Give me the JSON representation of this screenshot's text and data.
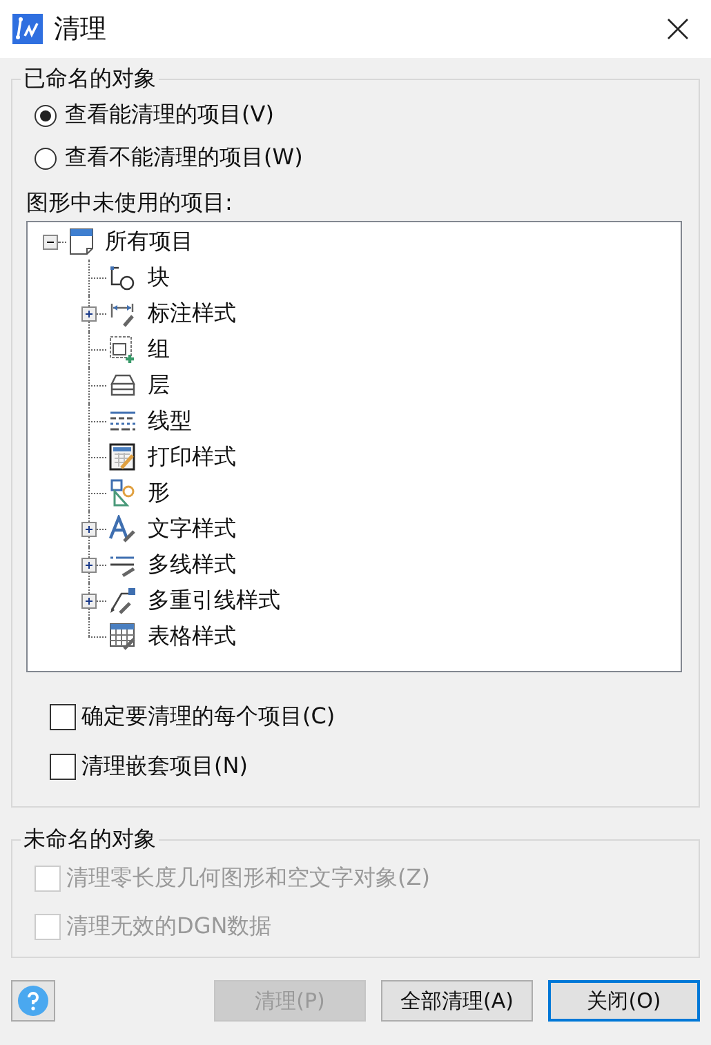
{
  "window": {
    "title": "清理"
  },
  "named_objects": {
    "title": "已命名的对象",
    "view_options": [
      {
        "label": "查看能清理的项目(V)",
        "selected": true
      },
      {
        "label": "查看不能清理的项目(W)",
        "selected": false
      }
    ],
    "tree_label": "图形中未使用的项目:",
    "tree": [
      {
        "label": "所有项目",
        "kind": "drawing",
        "expanded": true,
        "children": [
          {
            "label": "块",
            "kind": "block"
          },
          {
            "label": "标注样式",
            "kind": "dimension",
            "expanded": false
          },
          {
            "label": "组",
            "kind": "group"
          },
          {
            "label": "层",
            "kind": "layer"
          },
          {
            "label": "线型",
            "kind": "linetype"
          },
          {
            "label": "打印样式",
            "kind": "plotstyle"
          },
          {
            "label": "形",
            "kind": "shape"
          },
          {
            "label": "文字样式",
            "kind": "textstyle",
            "expanded": false
          },
          {
            "label": "多线样式",
            "kind": "mline",
            "expanded": false
          },
          {
            "label": "多重引线样式",
            "kind": "mleader",
            "expanded": false
          },
          {
            "label": "表格样式",
            "kind": "table"
          }
        ]
      }
    ],
    "options": [
      {
        "label": "确定要清理的每个项目(C)",
        "checked": false,
        "disabled": false
      },
      {
        "label": "清理嵌套项目(N)",
        "checked": false,
        "disabled": false
      }
    ]
  },
  "unnamed_objects": {
    "title": "未命名的对象",
    "options": [
      {
        "label": "清理零长度几何图形和空文字对象(Z)",
        "checked": false,
        "disabled": true
      },
      {
        "label": "清理无效的DGN数据",
        "checked": false,
        "disabled": true
      }
    ]
  },
  "buttons": [
    {
      "label": "清理(P)",
      "disabled": true,
      "default": false
    },
    {
      "label": "全部清理(A)",
      "disabled": false,
      "default": false
    },
    {
      "label": "关闭(O)",
      "disabled": false,
      "default": true
    }
  ]
}
